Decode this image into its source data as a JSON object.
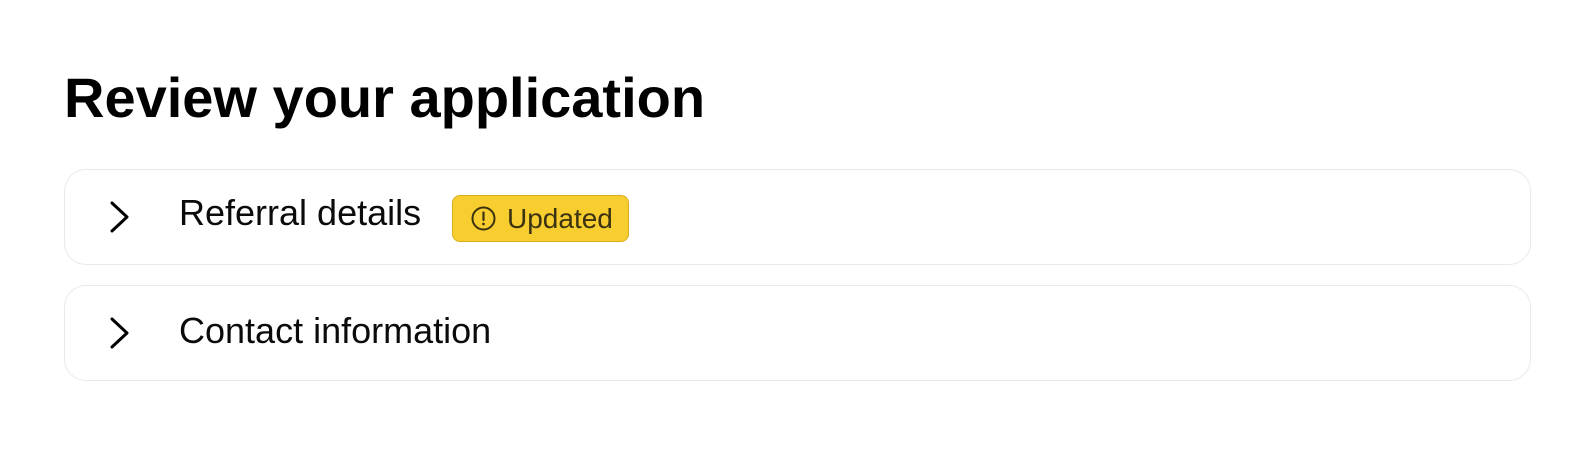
{
  "page": {
    "title": "Review your application"
  },
  "sections": [
    {
      "label": "Referral details",
      "expanded": false,
      "icon": "chevron-right-icon",
      "badge": {
        "label": "Updated",
        "icon": "alert-circle-icon",
        "color": "#f8cd2f"
      }
    },
    {
      "label": "Contact information",
      "expanded": false,
      "icon": "chevron-right-icon"
    }
  ]
}
